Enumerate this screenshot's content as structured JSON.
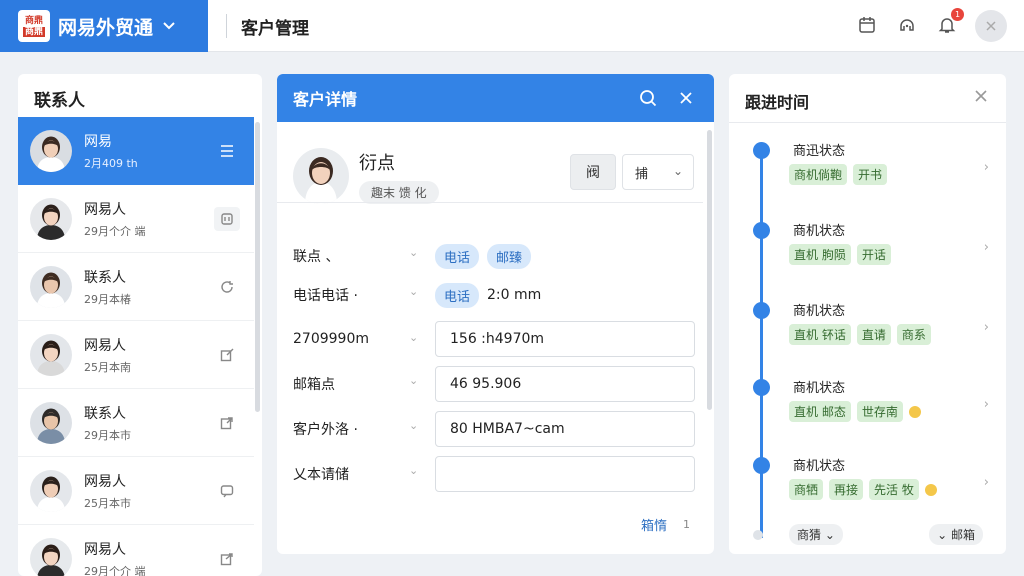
{
  "topbar": {
    "logo_top": "商鼎",
    "logo_bottom": "商鼎",
    "brand_name": "网易外贸通",
    "page_title": "客户管理",
    "notification_count": "1",
    "colors": {
      "brand": "#2d7be0",
      "accent": "#3383e6"
    }
  },
  "contacts": {
    "title": "联系人",
    "items": [
      {
        "name": "网易",
        "sub": "2月409 th",
        "action_icon": "menu-icon"
      },
      {
        "name": "网易人",
        "sub": "29月个介 端",
        "action_icon": "card-icon"
      },
      {
        "name": "联系人",
        "sub": "29月本椿",
        "action_icon": "refresh-icon"
      },
      {
        "name": "网易人",
        "sub": "25月本南",
        "action_icon": "edit-icon"
      },
      {
        "name": "联系人",
        "sub": "29月本市",
        "action_icon": "share-icon"
      },
      {
        "name": "网易人",
        "sub": "25月本市",
        "action_icon": "chat-icon"
      },
      {
        "name": "网易人",
        "sub": "29月个介 端",
        "action_icon": "export-icon"
      }
    ]
  },
  "detail": {
    "title": "客户详情",
    "profile": {
      "name": "衍点",
      "tag": "趣末 馈 化"
    },
    "button_label": "阀",
    "select_value": "捕",
    "rows": [
      {
        "label": "联点 、",
        "pills": [
          "电话",
          "邮臻"
        ]
      },
      {
        "label": "电话电话 ·",
        "pill": "电话",
        "text": "2:0 mm"
      },
      {
        "label": "2709990m",
        "input": "156 :h4970m"
      },
      {
        "label": "邮箱点",
        "input": "46 95.906"
      },
      {
        "label": "客户外洛 ·",
        "input": "80 HMBA7~cam"
      },
      {
        "label": "乂本请储",
        "input": ""
      }
    ],
    "footer_link": "箱惰",
    "footer_page": "1"
  },
  "timeline": {
    "title": "跟进时间",
    "entries": [
      {
        "title": "商迅状态",
        "tags": [
          "商机倘鞄",
          "开书"
        ],
        "dot": false
      },
      {
        "title": "商机状态",
        "tags": [
          "直机 朐陨",
          "开话"
        ],
        "dot": false
      },
      {
        "title": "商机状态",
        "tags": [
          "直机 钚话",
          "直请",
          "商系"
        ],
        "dot": false
      },
      {
        "title": "商机状态",
        "tags": [
          "直机 邮态",
          "世存南"
        ],
        "dot": true
      },
      {
        "title": "商机状态",
        "tags": [
          "商牺",
          "再接",
          "先活 牧"
        ],
        "dot": true
      }
    ],
    "footer_left": "商猜 ⌄",
    "footer_right": "⌄ 邮箱"
  }
}
